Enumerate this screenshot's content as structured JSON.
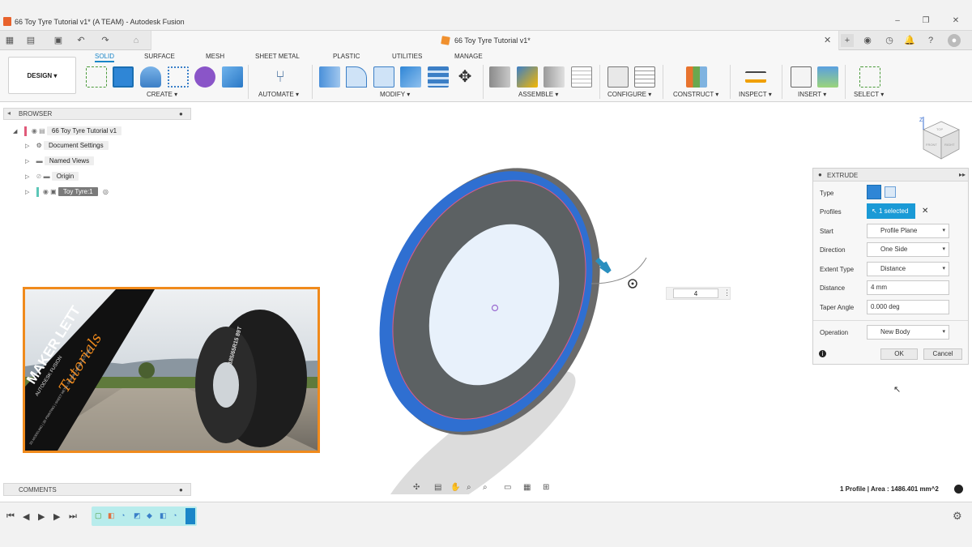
{
  "window": {
    "title": "66 Toy Tyre Tutorial v1* (A TEAM) - Autodesk Fusion",
    "controls": [
      "–",
      "❐",
      "✕"
    ]
  },
  "document_tab": {
    "name": "66 Toy Tyre Tutorial v1*"
  },
  "ribbon": {
    "workspace": "DESIGN",
    "tabs": [
      "SOLID",
      "SURFACE",
      "MESH",
      "SHEET METAL",
      "PLASTIC",
      "UTILITIES",
      "MANAGE"
    ],
    "active_tab": "SOLID",
    "groups": [
      "CREATE",
      "AUTOMATE",
      "MODIFY",
      "ASSEMBLE",
      "CONFIGURE",
      "CONSTRUCT",
      "INSPECT",
      "INSERT",
      "SELECT"
    ]
  },
  "browser": {
    "title": "BROWSER",
    "items": [
      {
        "label": "66 Toy Tyre Tutorial v1"
      },
      {
        "label": "Document Settings"
      },
      {
        "label": "Named Views"
      },
      {
        "label": "Origin"
      },
      {
        "label": "Toy Tyre:1"
      }
    ]
  },
  "thumbnail": {
    "banner_main": "MAKER LETT",
    "banner_script": "Tutorials",
    "banner_sub": "AUTODESK FUSION",
    "banner_strip": "3D MODELING | 3D PRINTING | SHEET METAL DESIGN | MANUFACTURING",
    "tyre_text": "185/65R15 89T"
  },
  "viewport": {
    "distance_value": "4",
    "status": "1 Profile | Area : 1486.401 mm^2"
  },
  "extrude": {
    "title": "EXTRUDE",
    "rows": {
      "type": "Type",
      "profiles": "Profiles",
      "profiles_value": "1 selected",
      "start": "Start",
      "start_value": "Profile Plane",
      "direction": "Direction",
      "direction_value": "One Side",
      "extent_type": "Extent Type",
      "extent_value": "Distance",
      "distance": "Distance",
      "distance_value": "4 mm",
      "taper": "Taper Angle",
      "taper_value": "0.000 deg",
      "operation": "Operation",
      "operation_value": "New Body"
    },
    "ok": "OK",
    "cancel": "Cancel"
  },
  "comments": {
    "title": "COMMENTS"
  },
  "viewcube": {
    "faces": [
      "TOP",
      "FRONT",
      "RIGHT"
    ],
    "axis": "Z"
  },
  "colors": {
    "accent": "#1a86c8",
    "tyre_blue": "#2f6fd1",
    "highlight": "#f08a1c"
  }
}
